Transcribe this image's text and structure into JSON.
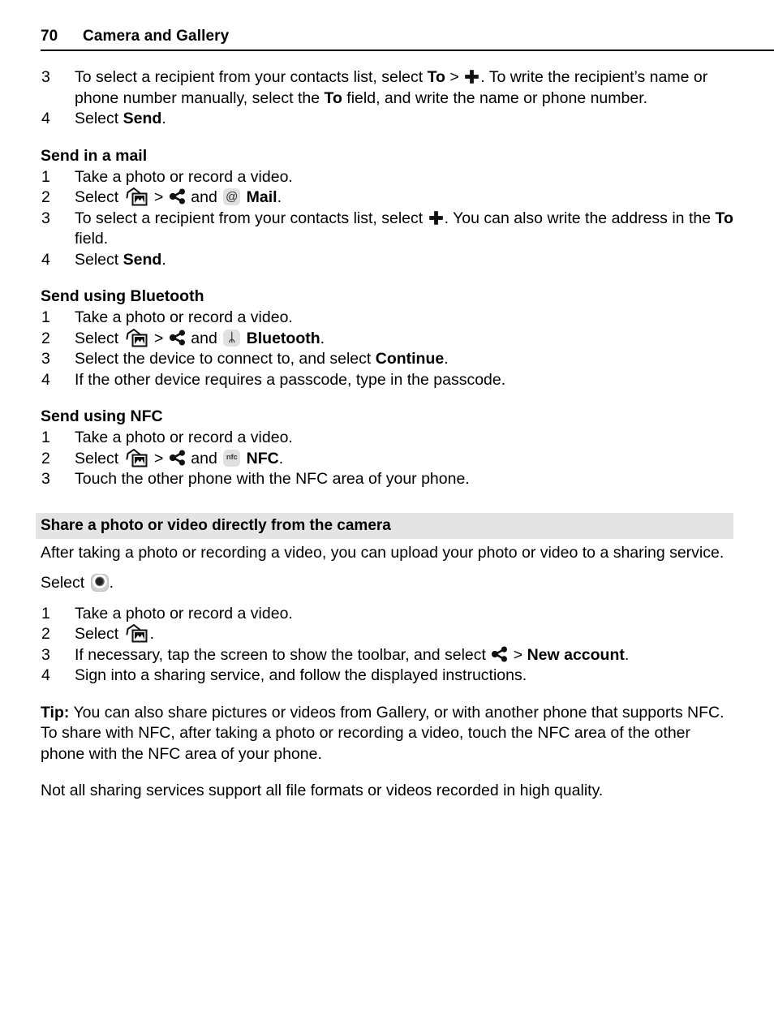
{
  "header": {
    "page_number": "70",
    "title": "Camera and Gallery"
  },
  "icons": {
    "gallery": "gallery-icon",
    "share": "share-icon",
    "plus": "plus-icon",
    "mail_badge": "@",
    "bluetooth_badge": "bluetooth-icon",
    "nfc_badge": "nfc",
    "camera": "camera-icon"
  },
  "colors": {
    "band_background": "#e4e4e4",
    "badge_background": "#e0e0e0",
    "rule": "#000000",
    "text": "#000000"
  },
  "top_steps": [
    {
      "num": "3",
      "parts": [
        {
          "t": "To select a recipient from your contacts list, select "
        },
        {
          "b": "To"
        },
        {
          "t": " > "
        },
        {
          "icon": "plus"
        },
        {
          "t": ". To write the recipient’s name or phone number manually, select the "
        },
        {
          "b": "To"
        },
        {
          "t": " field, and write the name or phone number."
        }
      ]
    },
    {
      "num": "4",
      "parts": [
        {
          "t": "Select "
        },
        {
          "b": "Send"
        },
        {
          "t": "."
        }
      ]
    }
  ],
  "sections": [
    {
      "title": "Send in a mail",
      "steps": [
        {
          "num": "1",
          "parts": [
            {
              "t": "Take a photo or record a video."
            }
          ]
        },
        {
          "num": "2",
          "parts": [
            {
              "t": "Select "
            },
            {
              "icon": "gallery"
            },
            {
              "t": " > "
            },
            {
              "icon": "share"
            },
            {
              "t": " and "
            },
            {
              "icon": "mail_badge"
            },
            {
              "t": " "
            },
            {
              "b": "Mail"
            },
            {
              "t": "."
            }
          ]
        },
        {
          "num": "3",
          "parts": [
            {
              "t": "To select a recipient from your contacts list, select "
            },
            {
              "icon": "plus"
            },
            {
              "t": ". You can also write the address in the "
            },
            {
              "b": "To"
            },
            {
              "t": " field."
            }
          ]
        },
        {
          "num": "4",
          "parts": [
            {
              "t": "Select "
            },
            {
              "b": "Send"
            },
            {
              "t": "."
            }
          ]
        }
      ]
    },
    {
      "title": "Send using Bluetooth",
      "steps": [
        {
          "num": "1",
          "parts": [
            {
              "t": "Take a photo or record a video."
            }
          ]
        },
        {
          "num": "2",
          "parts": [
            {
              "t": "Select "
            },
            {
              "icon": "gallery"
            },
            {
              "t": " > "
            },
            {
              "icon": "share"
            },
            {
              "t": " and "
            },
            {
              "icon": "bluetooth_badge"
            },
            {
              "t": " "
            },
            {
              "b": "Bluetooth"
            },
            {
              "t": "."
            }
          ]
        },
        {
          "num": "3",
          "parts": [
            {
              "t": "Select the device to connect to, and select "
            },
            {
              "b": "Continue"
            },
            {
              "t": "."
            }
          ]
        },
        {
          "num": "4",
          "parts": [
            {
              "t": "If the other device requires a passcode, type in the passcode."
            }
          ]
        }
      ]
    },
    {
      "title": "Send using NFC",
      "steps": [
        {
          "num": "1",
          "parts": [
            {
              "t": "Take a photo or record a video."
            }
          ]
        },
        {
          "num": "2",
          "parts": [
            {
              "t": "Select "
            },
            {
              "icon": "gallery"
            },
            {
              "t": " > "
            },
            {
              "icon": "share"
            },
            {
              "t": " and "
            },
            {
              "icon": "nfc_badge"
            },
            {
              "t": " "
            },
            {
              "b": "NFC"
            },
            {
              "t": "."
            }
          ]
        },
        {
          "num": "3",
          "parts": [
            {
              "t": "Touch the other phone with the NFC area of your phone."
            }
          ]
        }
      ]
    }
  ],
  "band": {
    "heading": "Share a photo or video directly from the camera"
  },
  "band_intro": {
    "parts": [
      {
        "t": "After taking a photo or recording a video, you can upload your photo or video to a sharing service."
      }
    ]
  },
  "select_line": {
    "parts": [
      {
        "t": "Select "
      },
      {
        "icon": "camera"
      },
      {
        "t": "."
      }
    ]
  },
  "bottom_steps": [
    {
      "num": "1",
      "parts": [
        {
          "t": "Take a photo or record a video."
        }
      ]
    },
    {
      "num": "2",
      "parts": [
        {
          "t": "Select "
        },
        {
          "icon": "gallery"
        },
        {
          "t": "."
        }
      ]
    },
    {
      "num": "3",
      "parts": [
        {
          "t": "If necessary, tap the screen to show the toolbar, and select "
        },
        {
          "icon": "share"
        },
        {
          "t": " > "
        },
        {
          "b": "New account"
        },
        {
          "t": "."
        }
      ]
    },
    {
      "num": "4",
      "parts": [
        {
          "t": "Sign into a sharing service, and follow the displayed instructions."
        }
      ]
    }
  ],
  "tip": {
    "parts": [
      {
        "b": "Tip:"
      },
      {
        "t": " You can also share pictures or videos from Gallery, or with another phone that supports NFC. To share with NFC, after taking a photo or recording a video, touch the NFC area of the other phone with the NFC area of your phone."
      }
    ]
  },
  "closing": {
    "parts": [
      {
        "t": "Not all sharing services support all file formats or videos recorded in high quality."
      }
    ]
  }
}
